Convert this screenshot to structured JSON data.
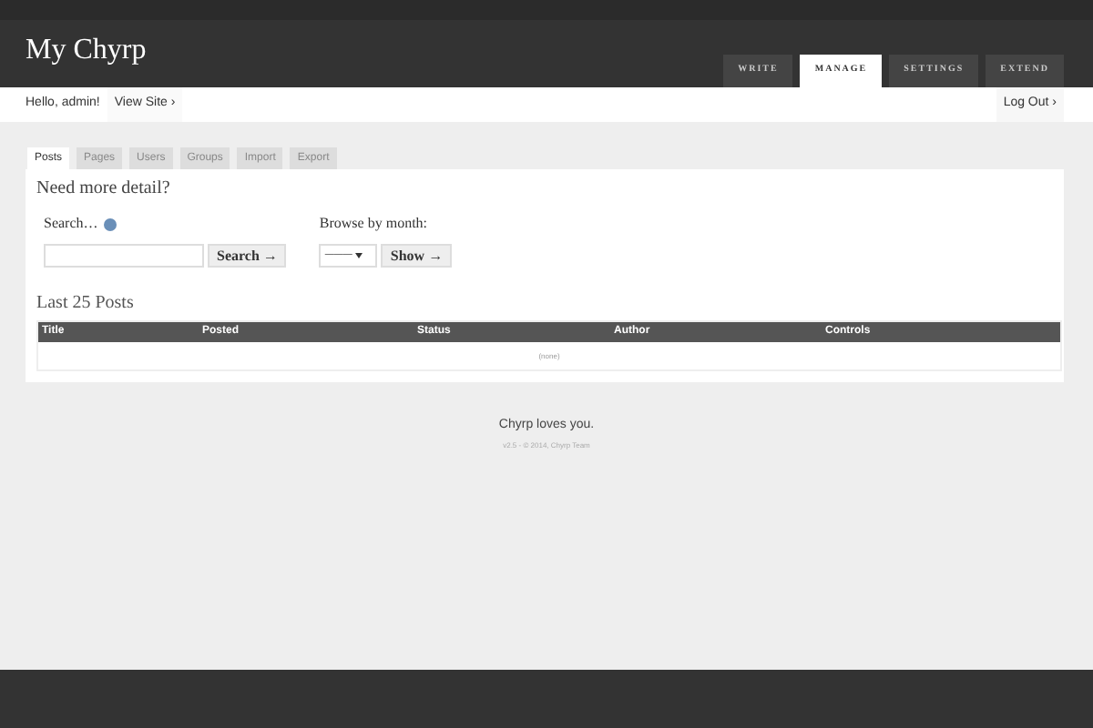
{
  "site_title": "My Chyrp",
  "main_nav": [
    {
      "label": "WRITE",
      "selected": false
    },
    {
      "label": "MANAGE",
      "selected": true
    },
    {
      "label": "SETTINGS",
      "selected": false
    },
    {
      "label": "EXTEND",
      "selected": false
    }
  ],
  "user_bar": {
    "greeting": "Hello, admin!",
    "view_site": "View Site ›",
    "log_out": "Log Out ›"
  },
  "sub_tabs": [
    {
      "label": "Posts",
      "selected": true
    },
    {
      "label": "Pages",
      "selected": false
    },
    {
      "label": "Users",
      "selected": false
    },
    {
      "label": "Groups",
      "selected": false
    },
    {
      "label": "Import",
      "selected": false
    },
    {
      "label": "Export",
      "selected": false
    }
  ],
  "heading": "Need more detail?",
  "search": {
    "label": "Search…",
    "button": "Search →"
  },
  "browse": {
    "label": "Browse by month:",
    "select": "———",
    "button": "Show →"
  },
  "table": {
    "title": "Last 25 Posts",
    "columns": [
      "Title",
      "Posted",
      "Status",
      "Author",
      "Controls"
    ],
    "empty": "(none)"
  },
  "footer": {
    "tagline": "Chyrp loves you.",
    "credit": "v2.5 - © 2014, Chyrp Team"
  }
}
